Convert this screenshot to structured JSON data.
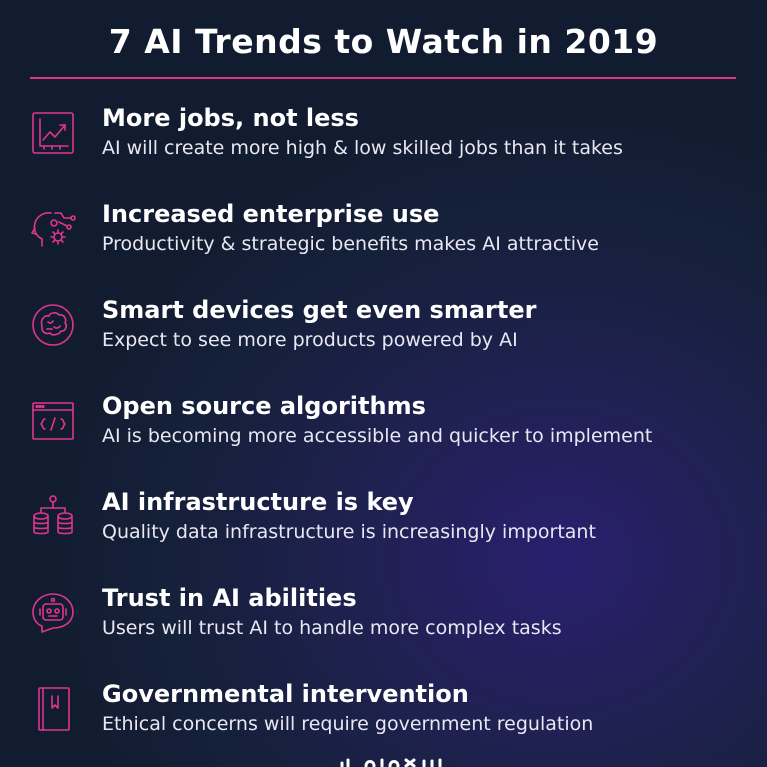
{
  "title": "7 AI Trends to Watch in 2019",
  "accent_color": "#e0368a",
  "items": [
    {
      "heading": "More jobs, not less",
      "sub": "AI will create more high & low skilled jobs than it takes",
      "icon": "growth-chart-icon"
    },
    {
      "heading": "Increased enterprise use",
      "sub": "Productivity & strategic benefits makes AI attractive",
      "icon": "head-gear-icon"
    },
    {
      "heading": "Smart devices get even smarter",
      "sub": "Expect to see more products powered by AI",
      "icon": "brain-icon"
    },
    {
      "heading": "Open source algorithms",
      "sub": "AI is becoming more accessible and quicker to implement",
      "icon": "code-window-icon"
    },
    {
      "heading": "AI infrastructure is key",
      "sub": "Quality data infrastructure is increasingly important",
      "icon": "database-network-icon"
    },
    {
      "heading": "Trust in AI abilities",
      "sub": "Users will trust AI to handle more complex tasks",
      "icon": "robot-chat-icon"
    },
    {
      "heading": "Governmental intervention",
      "sub": "Ethical concerns will require government regulation",
      "icon": "law-book-icon"
    }
  ]
}
